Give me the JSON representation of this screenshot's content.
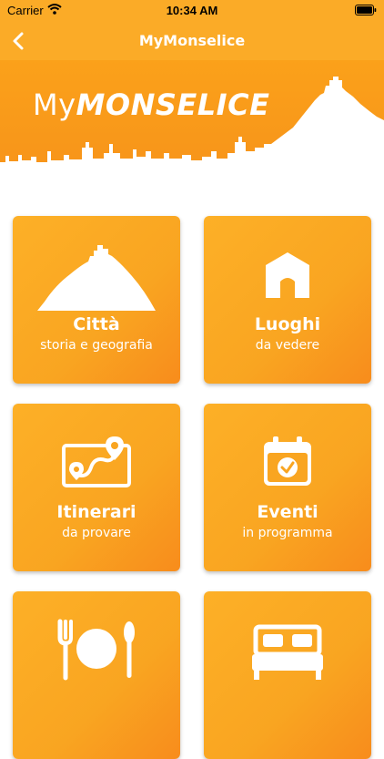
{
  "status": {
    "carrier": "Carrier",
    "time": "10:34 AM"
  },
  "nav": {
    "title": "MyMonselice"
  },
  "hero": {
    "brand_my": "My",
    "brand_name": "MONSELICE"
  },
  "tiles": [
    {
      "title": "Città",
      "subtitle": "storia e geografia",
      "icon": "hill-castle-icon"
    },
    {
      "title": "Luoghi",
      "subtitle": "da vedere",
      "icon": "building-icon"
    },
    {
      "title": "Itinerari",
      "subtitle": "da provare",
      "icon": "map-route-icon"
    },
    {
      "title": "Eventi",
      "subtitle": "in programma",
      "icon": "calendar-check-icon"
    },
    {
      "title": "",
      "subtitle": "",
      "icon": "restaurant-icon"
    },
    {
      "title": "",
      "subtitle": "",
      "icon": "bed-icon"
    }
  ],
  "colors": {
    "accent": "#fbab27",
    "tile_light": "#fdb027",
    "tile_dark": "#f88c1c"
  }
}
